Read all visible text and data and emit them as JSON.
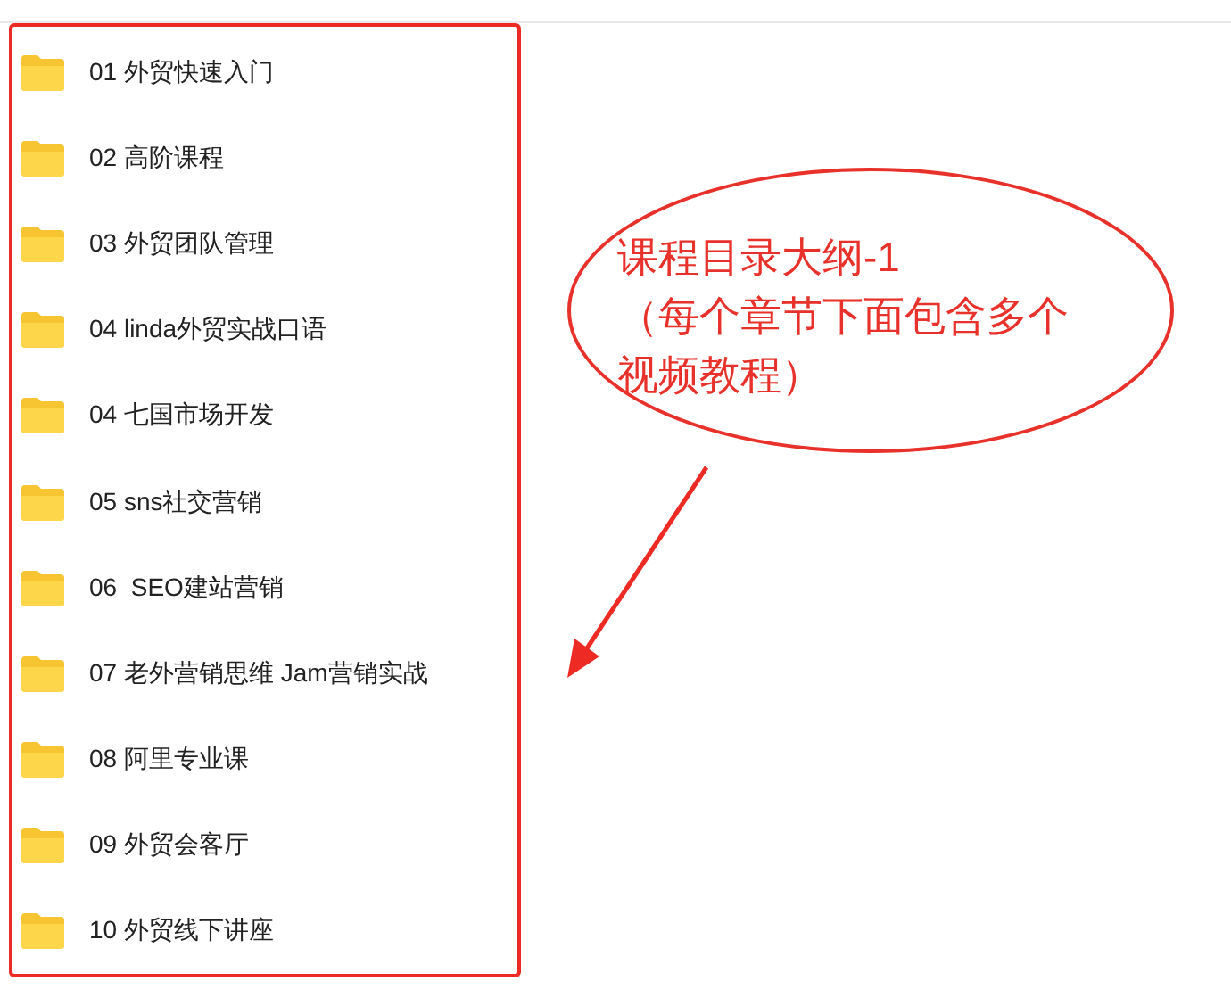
{
  "folders": [
    {
      "name": "01 外贸快速入门"
    },
    {
      "name": "02 高阶课程"
    },
    {
      "name": "03 外贸团队管理"
    },
    {
      "name": "04 linda外贸实战口语"
    },
    {
      "name": "04 七国市场开发"
    },
    {
      "name": "05 sns社交营销"
    },
    {
      "name": "06  SEO建站营销"
    },
    {
      "name": "07 老外营销思维 Jam营销实战"
    },
    {
      "name": "08 阿里专业课"
    },
    {
      "name": "09 外贸会客厅"
    },
    {
      "name": "10 外贸线下讲座"
    }
  ],
  "annotation": {
    "lines": [
      "课程目录大纲-1",
      "（每个章节下面包含多个",
      "视频教程）"
    ]
  }
}
